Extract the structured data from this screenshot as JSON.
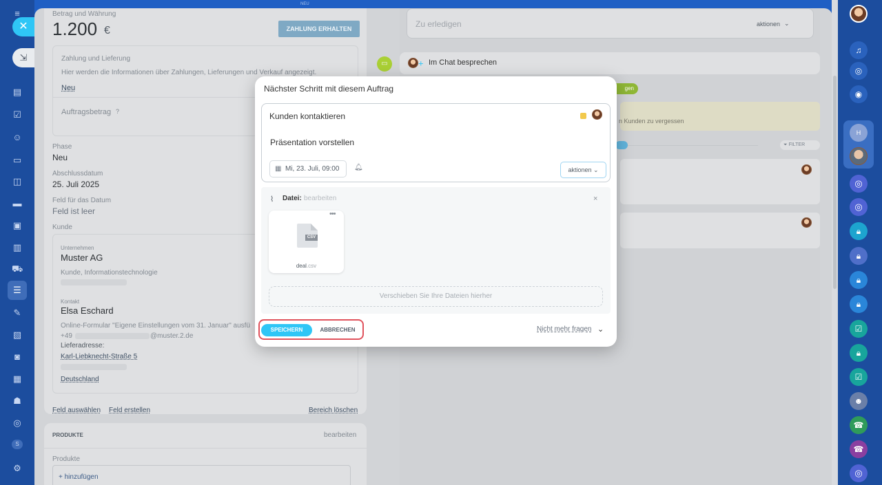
{
  "top_label": "NEU",
  "left_panel": {
    "amount_label": "Betrag und Währung",
    "amount_value": "1.200",
    "currency": "€",
    "receive_button": "ZAHLUNG ERHALTEN",
    "payment_title": "Zahlung und Lieferung",
    "payment_desc": "Hier werden die Informationen über Zahlungen, Lieferungen und Verkauf angezeigt.",
    "payment_new_link": "Neu",
    "order_amount_label": "Auftragsbetrag",
    "phase_label": "Phase",
    "phase_value": "Neu",
    "close_date_label": "Abschlussdatum",
    "close_date_value": "25. Juli 2025",
    "date_field_label": "Feld für das Datum",
    "date_field_value": "Feld ist leer",
    "customer_label": "Kunde",
    "company_label": "Unternehmen",
    "company_name": "Muster AG",
    "company_desc": "Kunde, Informationstechnologie",
    "contact_label": "Kontakt",
    "contact_name": "Elsa Eschard",
    "contact_source": "Online-Formular \"Eigene Einstellungen vom 31. Januar\" ausfü",
    "contact_phone_prefix": "+49",
    "contact_email_suffix": "@muster.2.de",
    "delivery_label": "Lieferadresse:",
    "street": "Karl-Liebknecht-Straße 5",
    "country": "Deutschland",
    "select_field": "Feld auswählen",
    "create_field": "Feld erstellen",
    "delete_section": "Bereich löschen",
    "products_title": "PRODUKTE",
    "products_edit": "bearbeiten",
    "products_label": "Produkte",
    "add_product": "+ hinzufügen"
  },
  "right_panel": {
    "todo_placeholder": "Zu erledigen",
    "todo_actions": "aktionen",
    "chat_label": "Im Chat besprechen",
    "badge_text": "gen",
    "reminder_text": "n Kunden zu vergessen",
    "filter_label": "FILTER"
  },
  "modal": {
    "title": "Nächster Schritt mit diesem Auftrag",
    "task_title": "Kunden kontaktieren",
    "task_desc": "Präsentation vorstellen",
    "date_chip": "Mi, 23. Juli, 09:00",
    "actions_dropdown": "aktionen",
    "file_label": "Datei:",
    "file_edit": "bearbeiten",
    "file_name": "deal",
    "file_ext": ".csv",
    "file_badge": "CSV",
    "drop_text": "Verschieben Sie Ihre Dateien hierher",
    "save_button": "SPEICHERN",
    "cancel_button": "ABBRECHEN",
    "dont_ask": "Nicht mehr fragen"
  },
  "left_nav_badge": "S",
  "colors": {
    "accent": "#2fc6f6",
    "sidebar": "#1c4d9e",
    "highlight": "#e0525c",
    "badge_green": "#9dcf00"
  }
}
